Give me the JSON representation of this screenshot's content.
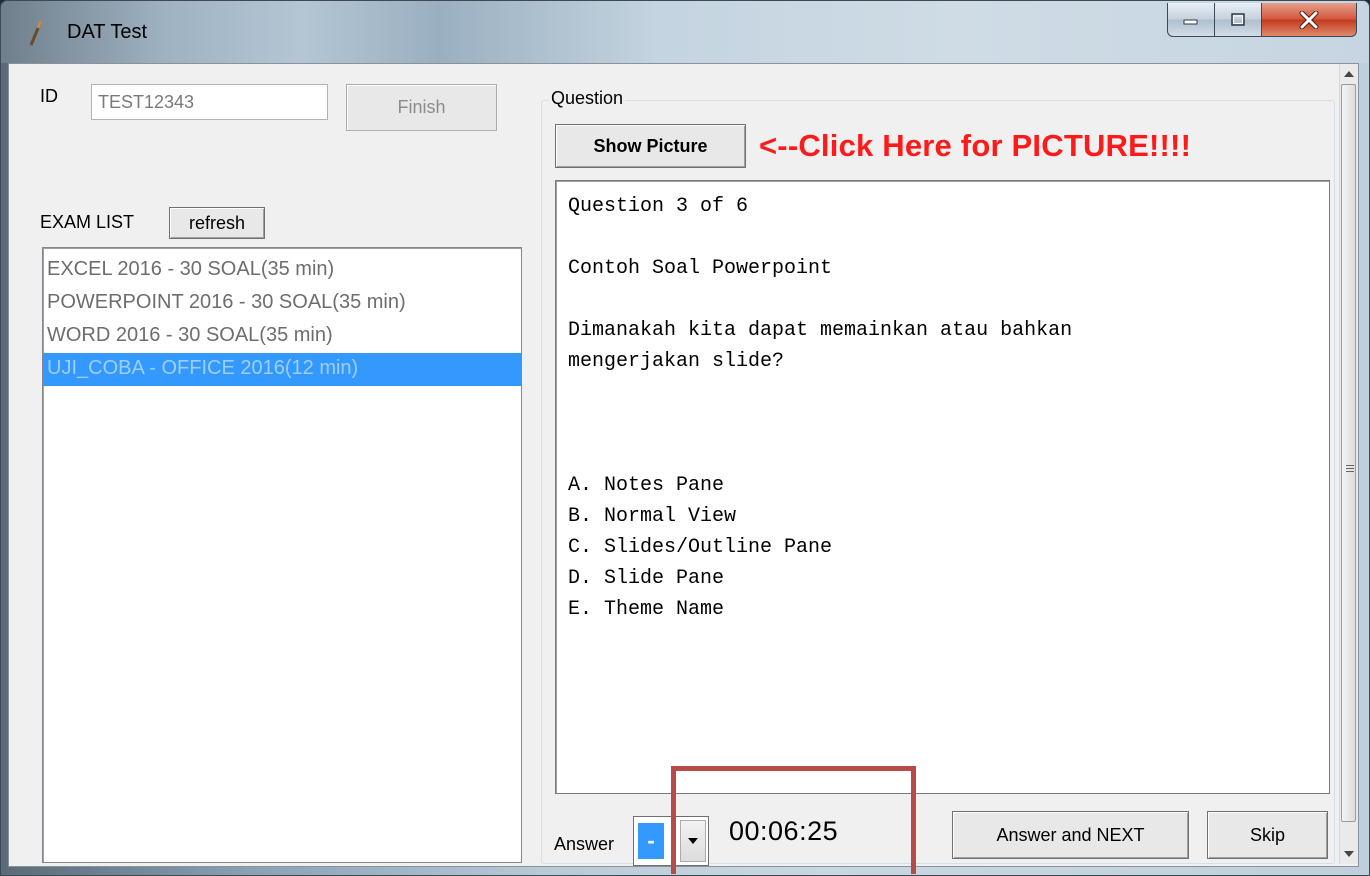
{
  "window": {
    "title": "DAT Test",
    "icons": {
      "app": "pen-icon",
      "minimize": "minimize-icon",
      "maximize": "maximize-icon",
      "close": "close-icon"
    }
  },
  "form": {
    "id_label": "ID",
    "id_value": "TEST12343",
    "finish_label": "Finish",
    "exam_list_label": "EXAM LIST",
    "refresh_label": "refresh"
  },
  "exam_list": [
    {
      "label": "EXCEL 2016 - 30 SOAL(35 min)",
      "selected": false
    },
    {
      "label": "POWERPOINT 2016 - 30 SOAL(35 min)",
      "selected": false
    },
    {
      "label": "WORD 2016 - 30 SOAL(35 min)",
      "selected": false
    },
    {
      "label": "UJI_COBA - OFFICE 2016(12 min)",
      "selected": true
    }
  ],
  "question": {
    "group_label": "Question",
    "show_picture_label": "Show Picture",
    "picture_hint": "<--Click Here for PICTURE!!!!",
    "counter": "Question 3 of 6",
    "topic": "Contoh Soal Powerpoint",
    "text_line1": "Dimanakah kita dapat memainkan atau bahkan",
    "text_line2": "mengerjakan slide?",
    "options": [
      "A. Notes Pane",
      "B. Normal View",
      "C. Slides/Outline Pane",
      "D. Slide Pane",
      "E. Theme Name"
    ]
  },
  "answer": {
    "label": "Answer",
    "selected_value": "-",
    "timer": "00:06:25",
    "answer_next_label": "Answer and NEXT",
    "skip_label": "Skip"
  },
  "colors": {
    "selection": "#3399ff",
    "hint_red": "#ff1a1a",
    "highlight_box": "#b64b48"
  }
}
